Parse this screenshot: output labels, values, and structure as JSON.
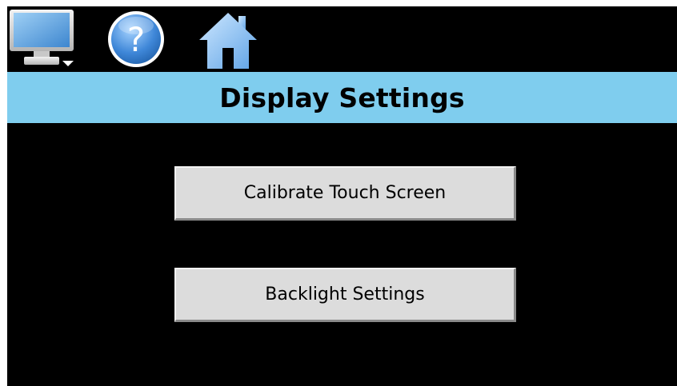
{
  "toolbar": {
    "monitor_icon": "monitor-dropdown-icon",
    "help_icon": "help-question-icon",
    "home_icon": "home-icon"
  },
  "header": {
    "title": "Display Settings"
  },
  "menu": {
    "calibrate_label": "Calibrate Touch Screen",
    "backlight_label": "Backlight Settings"
  },
  "colors": {
    "background": "#000000",
    "title_bar": "#7fcdee",
    "button_face": "#dcdcdc",
    "icon_blue": "#4a8ed4"
  }
}
